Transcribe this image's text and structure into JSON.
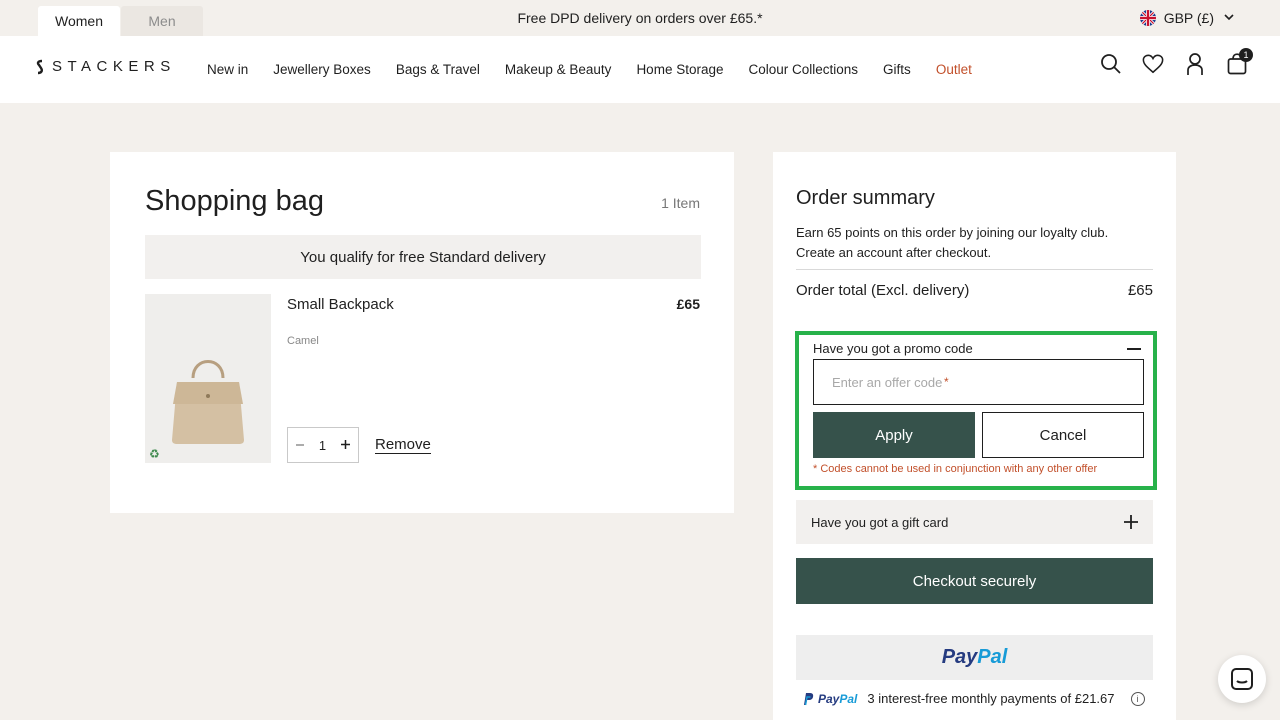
{
  "topbar": {
    "tabs": [
      {
        "label": "Women"
      },
      {
        "label": "Men"
      }
    ],
    "banner": "Free DPD delivery on orders over £65.*",
    "currency": "GBP (£)"
  },
  "header": {
    "logo": "STACKERS",
    "nav": [
      {
        "label": "New in"
      },
      {
        "label": "Jewellery Boxes"
      },
      {
        "label": "Bags & Travel"
      },
      {
        "label": "Makeup & Beauty"
      },
      {
        "label": "Home Storage"
      },
      {
        "label": "Colour Collections"
      },
      {
        "label": "Gifts"
      },
      {
        "label": "Outlet"
      }
    ],
    "cart_count": "1",
    "icons": [
      "search-icon",
      "heart-icon",
      "account-icon",
      "bag-icon"
    ]
  },
  "bag": {
    "title": "Shopping bag",
    "item_count": "1 Item",
    "delivery_note": "You qualify for free Standard delivery",
    "item": {
      "name": "Small Backpack",
      "price": "£65",
      "variant": "Camel",
      "quantity": "1",
      "remove_label": "Remove"
    }
  },
  "summary": {
    "title": "Order summary",
    "loyalty_line1": "Earn 65 points on this order by joining our loyalty club.",
    "loyalty_line2": "Create an account after checkout.",
    "total_label": "Order total (Excl. delivery)",
    "total_value": "£65",
    "promo": {
      "heading": "Have you got a promo code",
      "placeholder": "Enter an offer code",
      "required_mark": "*",
      "apply_label": "Apply",
      "cancel_label": "Cancel",
      "warning": "* Codes cannot be used in conjunction with any other offer"
    },
    "giftcard_label": "Have you got a gift card",
    "checkout_label": "Checkout securely",
    "paypal": {
      "word_a": "Pay",
      "word_b": "Pal"
    },
    "paylater_text": "3 interest-free monthly payments of £21.67"
  },
  "colors": {
    "accent": "#36524b",
    "outlet": "#c2502b",
    "highlight": "#27b24a",
    "background": "#f3f0ec"
  }
}
